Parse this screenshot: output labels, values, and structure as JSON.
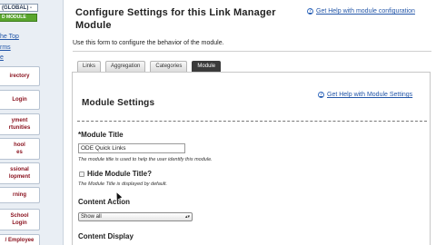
{
  "sidebar": {
    "global_label": "(GLOBAL) -",
    "module_label": "D MODULE",
    "links": [
      "he Top",
      "rms",
      "e"
    ],
    "items": [
      {
        "label": "irectory"
      },
      {
        "label": "Login"
      },
      {
        "label": "yment\nrtunities"
      },
      {
        "label": "hool\nes"
      },
      {
        "label": "ssional\nlopment"
      },
      {
        "label": "rning"
      },
      {
        "label": "School\nLogin"
      },
      {
        "label": "/ Employee"
      }
    ]
  },
  "header": {
    "title": "Configure Settings for this Link Manager Module",
    "help_link": "Get Help with module configuration",
    "description": "Use this form to configure the behavior of the module."
  },
  "tabs": [
    {
      "label": "Links",
      "active": false
    },
    {
      "label": "Aggregation",
      "active": false
    },
    {
      "label": "Categories",
      "active": false
    },
    {
      "label": "Module",
      "active": true
    }
  ],
  "panel": {
    "title": "Module Settings",
    "help_link": "Get Help with Module Settings",
    "module_title": {
      "label": "*Module Title",
      "value": "ODE Quick Links",
      "help": "The module title is used to help the user identify this module."
    },
    "hide_title": {
      "label": "Hide Module Title?",
      "help": "The Module Title is displayed by default."
    },
    "content_action": {
      "label": "Content Action",
      "selected": "Show all"
    },
    "content_display": {
      "label": "Content Display"
    }
  },
  "colors": {
    "link": "#2356a8",
    "sidebar_item_text": "#8b1420",
    "module_button": "#5aa62e",
    "active_tab": "#3b3b3b"
  }
}
